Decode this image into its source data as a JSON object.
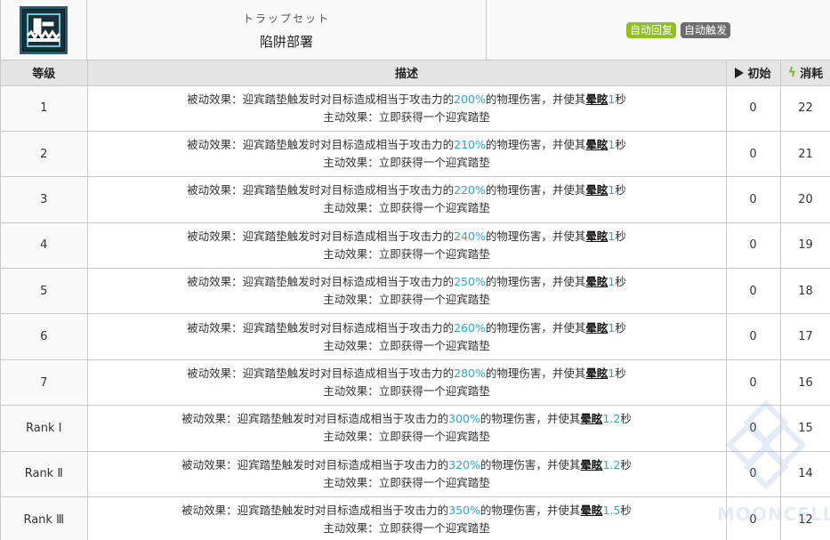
{
  "header": {
    "skill_icon": "trap-skill-icon",
    "title_jp": "トラップセット",
    "title_cn": "陷阱部署",
    "tags": [
      {
        "label": "自动回复",
        "color": "#8fbe2a"
      },
      {
        "label": "自动触发",
        "color": "#6d6d6d"
      }
    ]
  },
  "table": {
    "headers": {
      "level": "等级",
      "desc": "描述",
      "initial": "初始",
      "cost": "消耗"
    },
    "initial_icon": "play-icon",
    "cost_icon": "lightning-icon",
    "rows": [
      {
        "level": "1",
        "pre": "被动效果：迎宾踏垫触发时对目标造成相当于攻击力的",
        "pct": "200%",
        "mid": "的物理伤害，并使其",
        "stun": "晕眩",
        "dur": "1",
        "unit": "秒",
        "active": "主动效果：立即获得一个迎宾踏垫",
        "initial": "0",
        "cost": "22"
      },
      {
        "level": "2",
        "pre": "被动效果：迎宾踏垫触发时对目标造成相当于攻击力的",
        "pct": "210%",
        "mid": "的物理伤害，并使其",
        "stun": "晕眩",
        "dur": "1",
        "unit": "秒",
        "active": "主动效果：立即获得一个迎宾踏垫",
        "initial": "0",
        "cost": "21"
      },
      {
        "level": "3",
        "pre": "被动效果：迎宾踏垫触发时对目标造成相当于攻击力的",
        "pct": "220%",
        "mid": "的物理伤害，并使其",
        "stun": "晕眩",
        "dur": "1",
        "unit": "秒",
        "active": "主动效果：立即获得一个迎宾踏垫",
        "initial": "0",
        "cost": "20"
      },
      {
        "level": "4",
        "pre": "被动效果：迎宾踏垫触发时对目标造成相当于攻击力的",
        "pct": "240%",
        "mid": "的物理伤害，并使其",
        "stun": "晕眩",
        "dur": "1",
        "unit": "秒",
        "active": "主动效果：立即获得一个迎宾踏垫",
        "initial": "0",
        "cost": "19"
      },
      {
        "level": "5",
        "pre": "被动效果：迎宾踏垫触发时对目标造成相当于攻击力的",
        "pct": "250%",
        "mid": "的物理伤害，并使其",
        "stun": "晕眩",
        "dur": "1",
        "unit": "秒",
        "active": "主动效果：立即获得一个迎宾踏垫",
        "initial": "0",
        "cost": "18"
      },
      {
        "level": "6",
        "pre": "被动效果：迎宾踏垫触发时对目标造成相当于攻击力的",
        "pct": "260%",
        "mid": "的物理伤害，并使其",
        "stun": "晕眩",
        "dur": "1",
        "unit": "秒",
        "active": "主动效果：立即获得一个迎宾踏垫",
        "initial": "0",
        "cost": "17"
      },
      {
        "level": "7",
        "pre": "被动效果：迎宾踏垫触发时对目标造成相当于攻击力的",
        "pct": "280%",
        "mid": "的物理伤害，并使其",
        "stun": "晕眩",
        "dur": "1",
        "unit": "秒",
        "active": "主动效果：立即获得一个迎宾踏垫",
        "initial": "0",
        "cost": "16"
      },
      {
        "level": "Rank Ⅰ",
        "pre": "被动效果：迎宾踏垫触发时对目标造成相当于攻击力的",
        "pct": "300%",
        "mid": "的物理伤害，并使其",
        "stun": "晕眩",
        "dur": "1.2",
        "unit": "秒",
        "active": "主动效果：立即获得一个迎宾踏垫",
        "initial": "0",
        "cost": "15"
      },
      {
        "level": "Rank Ⅱ",
        "pre": "被动效果：迎宾踏垫触发时对目标造成相当于攻击力的",
        "pct": "320%",
        "mid": "的物理伤害，并使其",
        "stun": "晕眩",
        "dur": "1.2",
        "unit": "秒",
        "active": "主动效果：立即获得一个迎宾踏垫",
        "initial": "0",
        "cost": "14"
      },
      {
        "level": "Rank Ⅲ",
        "pre": "被动效果：迎宾踏垫触发时对目标造成相当于攻击力的",
        "pct": "350%",
        "mid": "的物理伤害，并使其",
        "stun": "晕眩",
        "dur": "1.5",
        "unit": "秒",
        "active": "主动效果：立即获得一个迎宾踏垫",
        "initial": "0",
        "cost": "12"
      }
    ]
  },
  "watermark": {
    "text": "MOONCELL"
  },
  "colors": {
    "highlight": "#2aa3d9",
    "header_bg": "#e4e4e4",
    "tag_green": "#8fbe2a",
    "tag_gray": "#6d6d6d",
    "cost_icon": "#7fb62a"
  }
}
